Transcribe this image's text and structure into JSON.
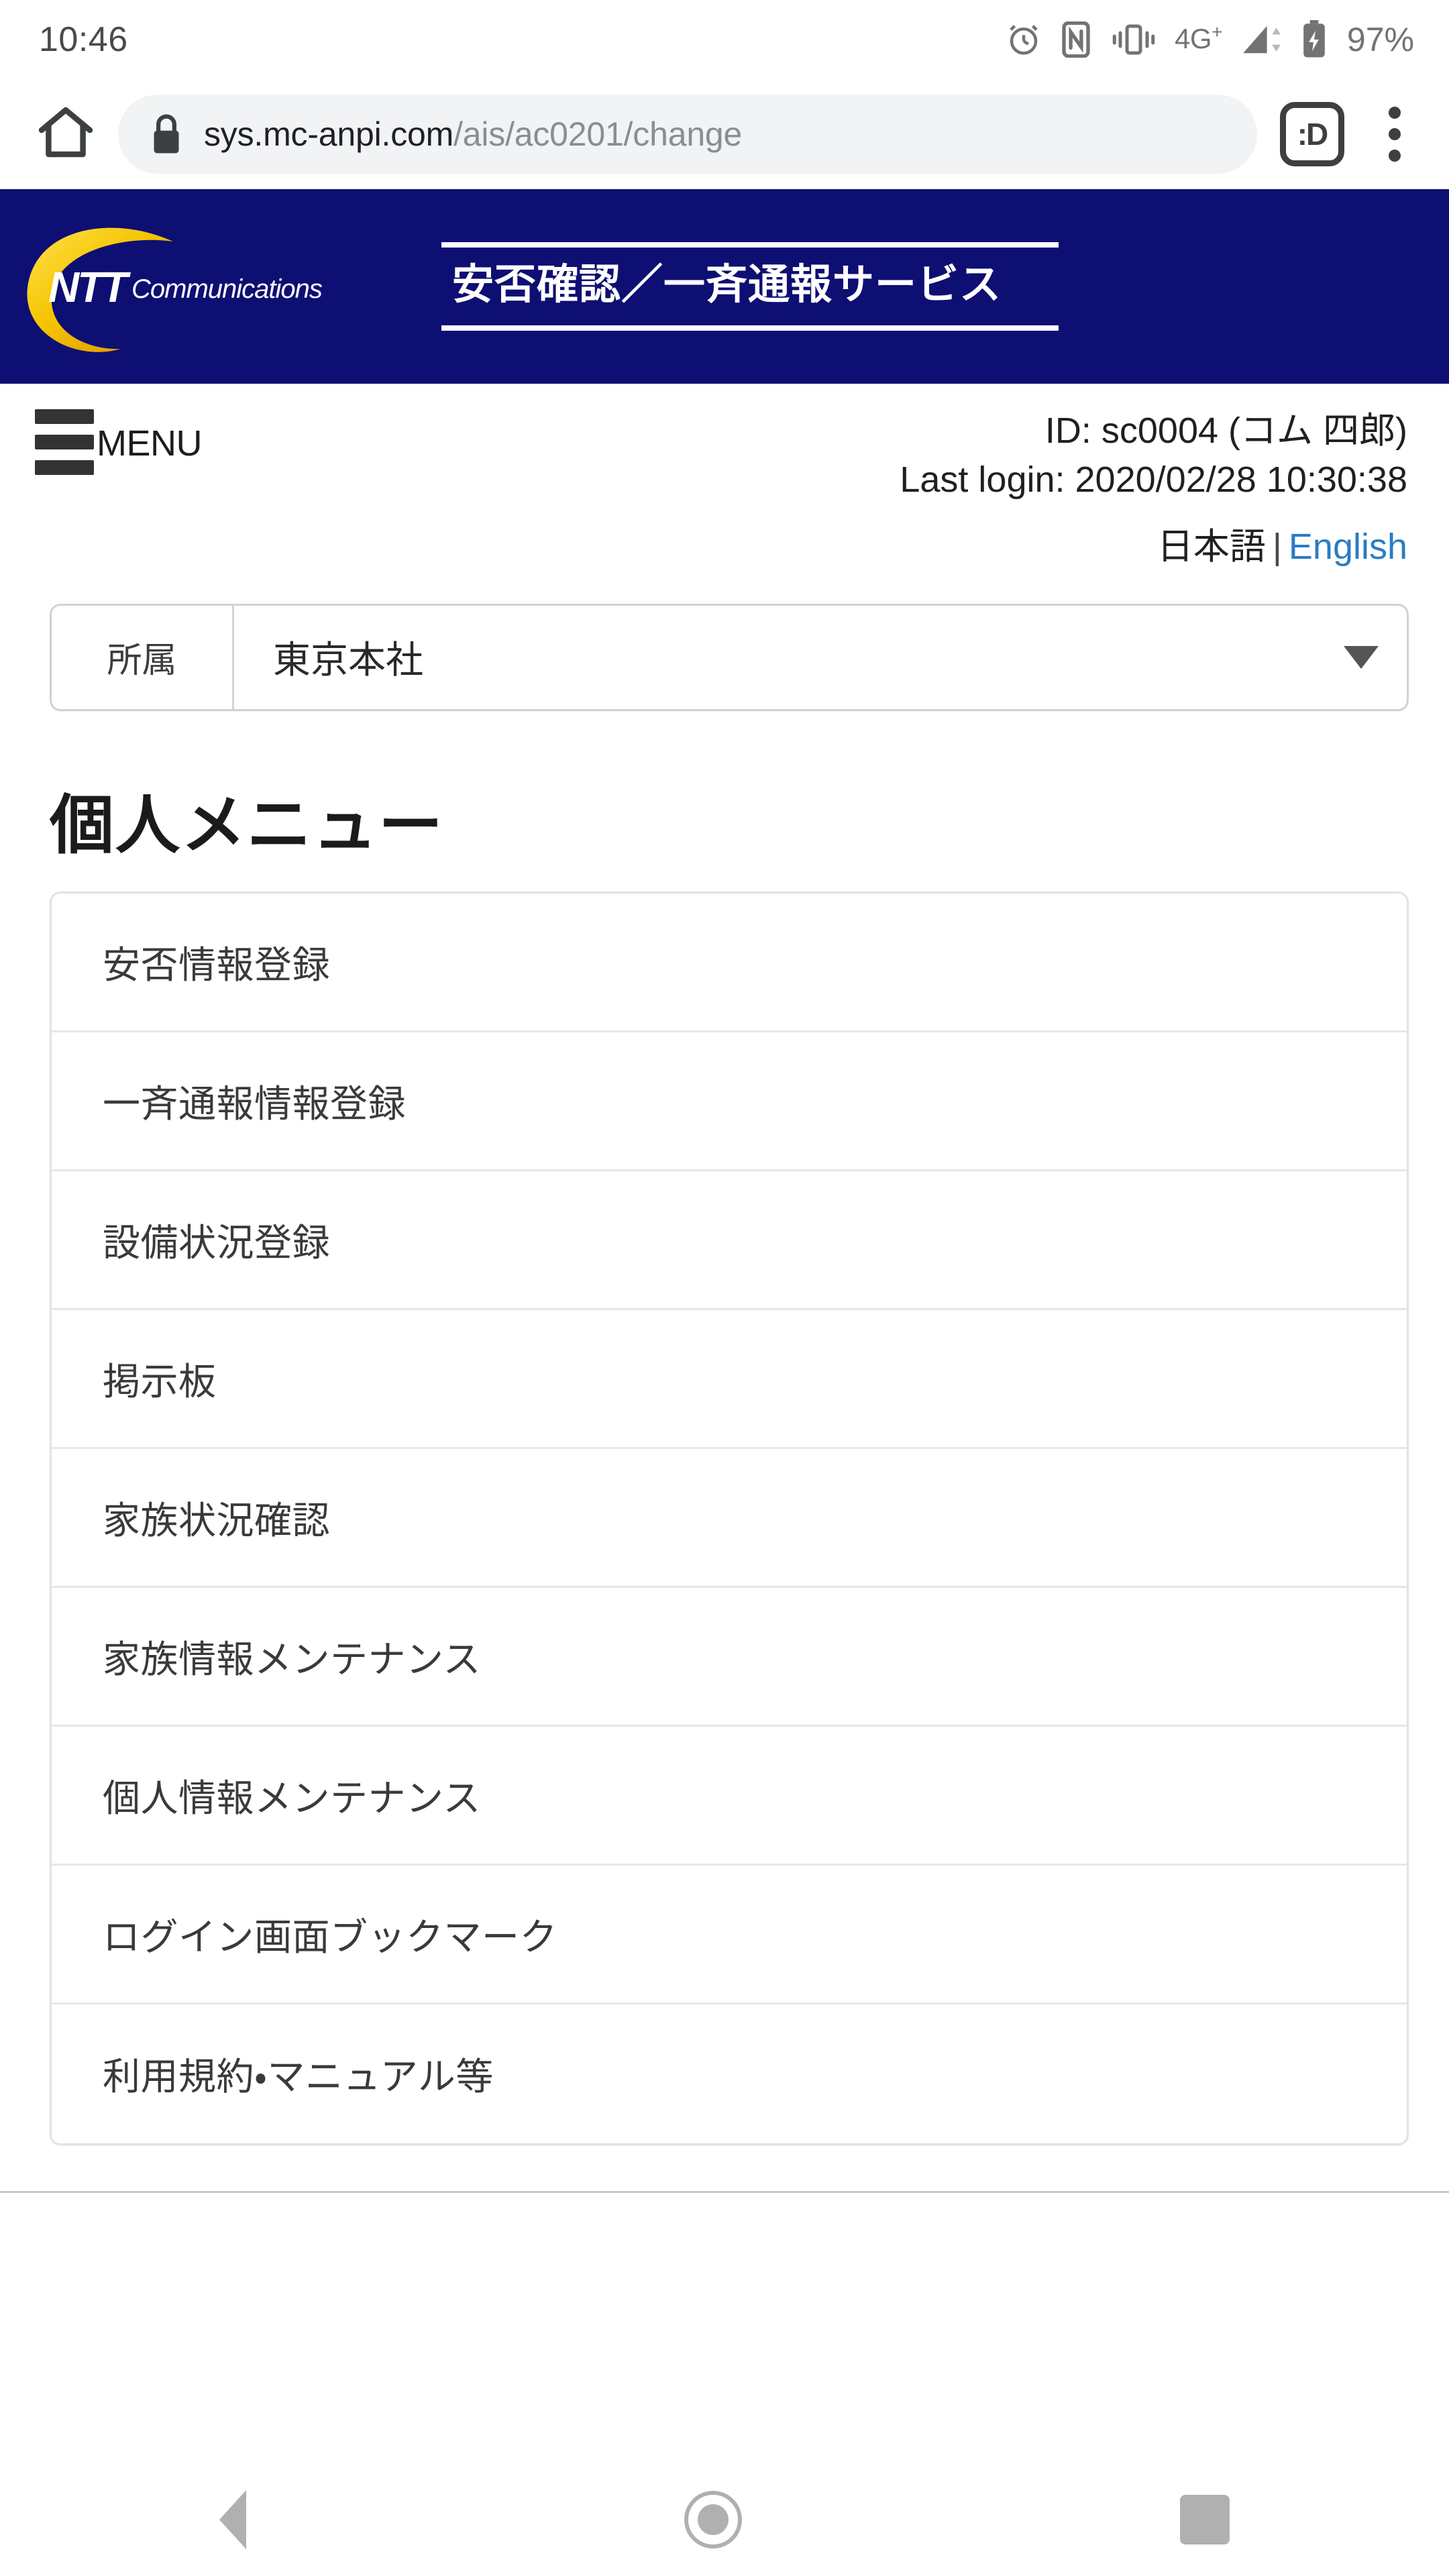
{
  "status_bar": {
    "time": "10:46",
    "network_label": "4G",
    "network_sup": "+",
    "battery_percent": "97%",
    "icons": [
      "alarm-icon",
      "nfc-icon",
      "vibrate-icon",
      "signal-bars-icon",
      "battery-charging-icon"
    ]
  },
  "browser": {
    "home_icon": "home-icon",
    "lock_icon": "lock-icon",
    "url_domain": "sys.mc-anpi.com",
    "url_path": "/ais/ac0201/change",
    "tab_switcher_label": ":D",
    "overflow_icon": "three-dot-menu-icon"
  },
  "site_header": {
    "logo_text_primary": "NTT",
    "logo_text_secondary": "Communications",
    "service_title": "安否確認／一斉通報サービス",
    "background_color": "#0e0f72",
    "logo_arc_color": "#f2b705"
  },
  "account_bar": {
    "menu_label": "MENU",
    "menu_icon": "hamburger-icon",
    "user_id": "ID: sc0004 (コム 四郎)",
    "last_login": "Last login: 2020/02/28 10:30:38",
    "lang_ja": "日本語",
    "lang_separator": "|",
    "lang_en": "English",
    "lang_link_color": "#2b7cc4"
  },
  "affiliation_select": {
    "label": "所属",
    "value": "東京本社",
    "caret_icon": "chevron-down-icon"
  },
  "main": {
    "heading": "個人メニュー",
    "items": [
      {
        "label": "安否情報登録"
      },
      {
        "label": "一斉通報情報登録"
      },
      {
        "label": "設備状況登録"
      },
      {
        "label": "掲示板"
      },
      {
        "label": "家族状況確認"
      },
      {
        "label": "家族情報メンテナンス"
      },
      {
        "label": "個人情報メンテナンス"
      },
      {
        "label": "ログイン画面ブックマーク"
      },
      {
        "label": "利用規約・マニュアル等"
      }
    ]
  },
  "android_nav": {
    "back_icon": "back-triangle-icon",
    "home_icon": "home-circle-icon",
    "recents_icon": "recents-square-icon"
  }
}
